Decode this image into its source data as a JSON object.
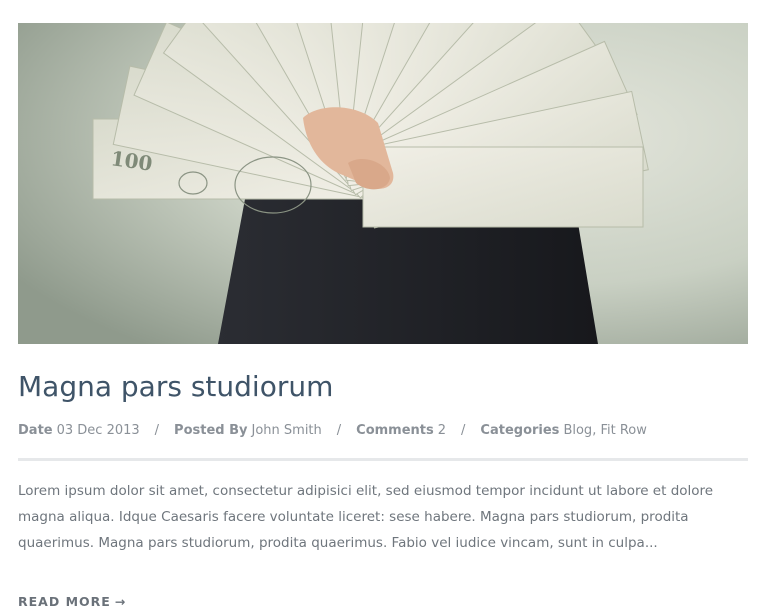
{
  "post": {
    "image_alt": "Hand holding a fan of hundred dollar bills",
    "title": "Magna pars studiorum",
    "meta": {
      "date_label": "Date",
      "date_value": "03 Dec 2013",
      "posted_by_label": "Posted By",
      "author": "John Smith",
      "comments_label": "Comments",
      "comments_count": "2",
      "categories_label": "Categories",
      "categories": [
        "Blog",
        "Fit Row"
      ],
      "separator": "/",
      "category_separator": ","
    },
    "excerpt": "Lorem ipsum dolor sit amet, consectetur adipisici elit, sed eiusmod tempor incidunt ut labore et dolore magna aliqua. Idque Caesaris facere voluntate liceret: sese habere. Magna pars studiorum, prodita quaerimus. Magna pars studiorum, prodita quaerimus. Fabio vel iudice vincam, sunt in culpa...",
    "read_more_label": "READ MORE",
    "read_more_arrow": "→"
  },
  "colors": {
    "title": "#3f5468",
    "meta": "#8a9097",
    "text": "#6f767d",
    "divider": "#e6e8ea"
  }
}
